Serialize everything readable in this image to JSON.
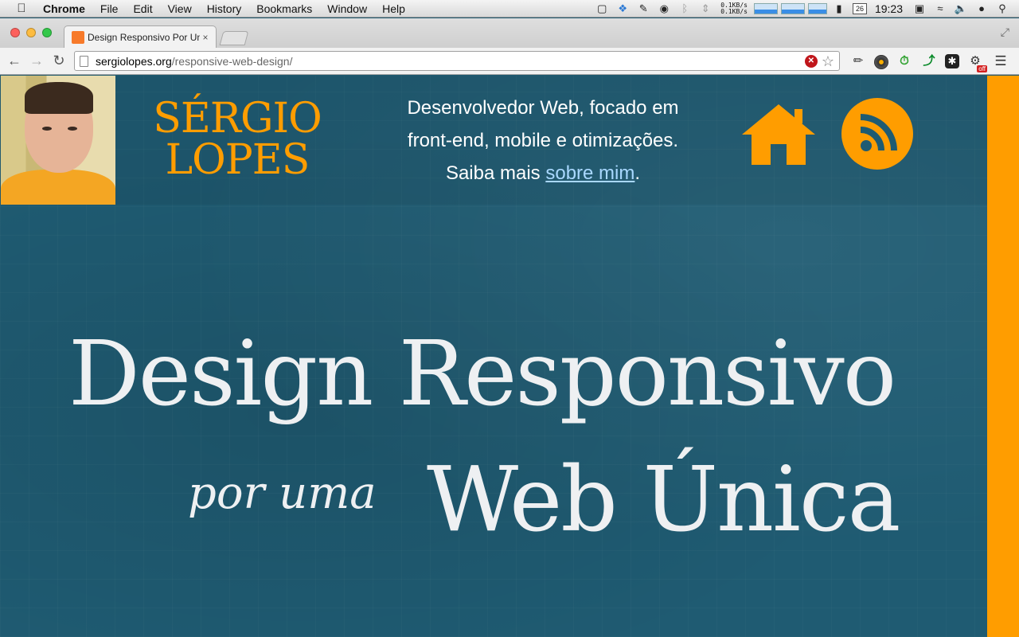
{
  "menubar": {
    "app_name": "Chrome",
    "items": [
      "File",
      "Edit",
      "View",
      "History",
      "Bookmarks",
      "Window",
      "Help"
    ],
    "net_up": "0.1KB/s",
    "net_down": "0.1KB/s",
    "calendar_day": "26",
    "clock": "19:23"
  },
  "browser": {
    "tab_title": "Design Responsivo Por Um",
    "tab_close": "×",
    "url_host": "sergiolopes.org",
    "url_path": "/responsive-web-design/",
    "ext_off_badge": "off",
    "colors": {
      "favicon": "#f77a2a"
    }
  },
  "site": {
    "logo_line1": "SÉRGIO",
    "logo_line2": "LOPES",
    "tagline_line1": "Desenvolvedor Web, focado em",
    "tagline_line2": "front-end, mobile e otimizações.",
    "tagline_prefix": "Saiba mais",
    "tagline_link": "sobre mim",
    "tagline_suffix": ".",
    "colors": {
      "accent": "#ff9d00",
      "background": "#1f5b72",
      "link": "#a9d8ff"
    }
  },
  "hero": {
    "line1": "Design Responsivo",
    "line2_small": "por uma",
    "line2_big": "Web Única"
  }
}
